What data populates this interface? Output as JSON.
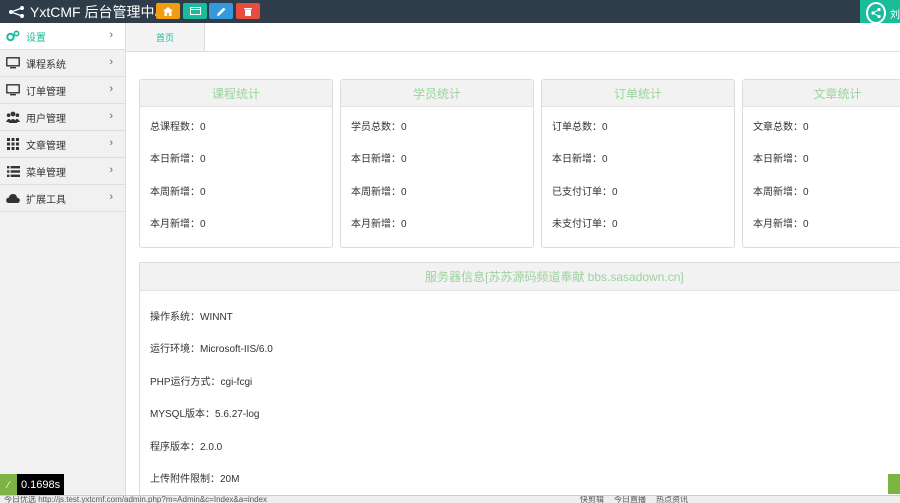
{
  "header": {
    "title": "YxtCMF 后台管理中心",
    "right_label": "刘"
  },
  "sidebar": {
    "items": [
      {
        "label": "设置",
        "icon": "gears-icon"
      },
      {
        "label": "课程系统",
        "icon": "monitor-icon"
      },
      {
        "label": "订单管理",
        "icon": "monitor-icon"
      },
      {
        "label": "用户管理",
        "icon": "users-icon"
      },
      {
        "label": "文章管理",
        "icon": "grid-icon"
      },
      {
        "label": "菜单管理",
        "icon": "list-icon"
      },
      {
        "label": "扩展工具",
        "icon": "cloud-icon"
      }
    ]
  },
  "tabs": {
    "home": "首页"
  },
  "cards": {
    "course": {
      "title": "课程统计",
      "rows": [
        "总课程数：0",
        "本日新增：0",
        "本周新增：0",
        "本月新增：0"
      ]
    },
    "student": {
      "title": "学员统计",
      "rows": [
        "学员总数：0",
        "本日新增：0",
        "本周新增：0",
        "本月新增：0"
      ]
    },
    "order": {
      "title": "订单统计",
      "rows": [
        "订单总数：0",
        "本日新增：0",
        "已支付订单：0",
        "未支付订单：0"
      ]
    },
    "article": {
      "title": "文章统计",
      "rows": [
        "文章总数：0",
        "本日新增：0",
        "本周新增：0",
        "本月新增：0"
      ]
    }
  },
  "server": {
    "title": "服务器信息[苏苏源码频道奉献 bbs.sasadown.cn]",
    "rows": [
      "操作系统：WINNT",
      "运行环境：Microsoft-IIS/6.0",
      "PHP运行方式：cgi-fcgi",
      "MYSQL版本：5.6.27-log",
      "程序版本：2.0.0",
      "上传附件限制：20M"
    ]
  },
  "timer": "0.1698s",
  "statusbar": {
    "left": "今日优选  http://js.test.yxtcmf.com/admin.php?m=Admin&c=Index&a=index",
    "right": [
      "快剪辑",
      "今日直播",
      "热点资讯"
    ]
  },
  "colors": {
    "topbar": "#2f3d4a",
    "accent": "#1abc9c",
    "card_title": "#9bd39d"
  }
}
